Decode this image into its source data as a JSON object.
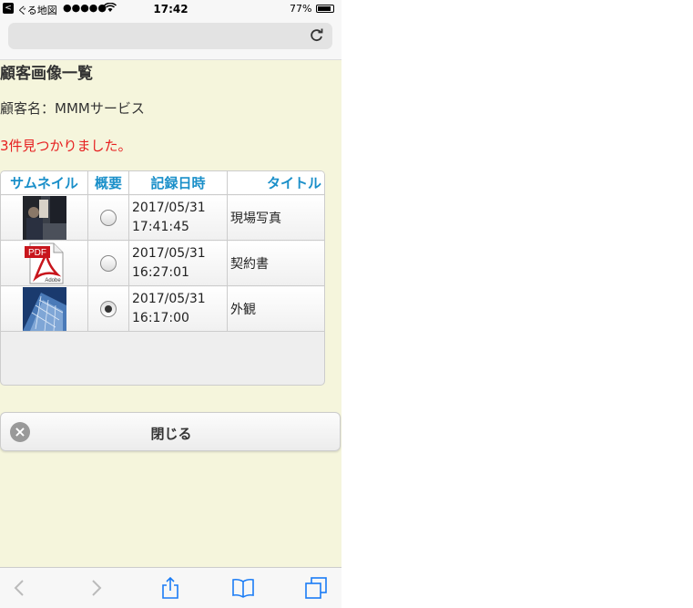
{
  "status_bar": {
    "back_app": "ぐる地図",
    "signal": "●●●●●",
    "time": "17:42",
    "battery": "77%"
  },
  "page": {
    "title": "顧客画像一覧",
    "customer_label": "顧客名：MMMサービス",
    "found_message": "3件見つかりました。",
    "found_color": "#e62020"
  },
  "table": {
    "headers": [
      "サムネイル",
      "概要",
      "記録日時",
      "タイトル"
    ],
    "rows": [
      {
        "thumb_icon": "photo-thumbnail-icon",
        "selected": false,
        "date": "2017/05/31",
        "time": "17:41:45",
        "title": "現場写真"
      },
      {
        "thumb_icon": "pdf-file-icon",
        "selected": false,
        "date": "2017/05/31",
        "time": "16:27:01",
        "title": "契約書"
      },
      {
        "thumb_icon": "building-photo-thumbnail-icon",
        "selected": true,
        "date": "2017/05/31",
        "time": "16:17:00",
        "title": "外観"
      }
    ],
    "header_color": "#1a8fc9"
  },
  "close_button": {
    "label": "閉じる"
  },
  "pdf_icon": {
    "label": "PDF",
    "brand": "Adobe"
  }
}
